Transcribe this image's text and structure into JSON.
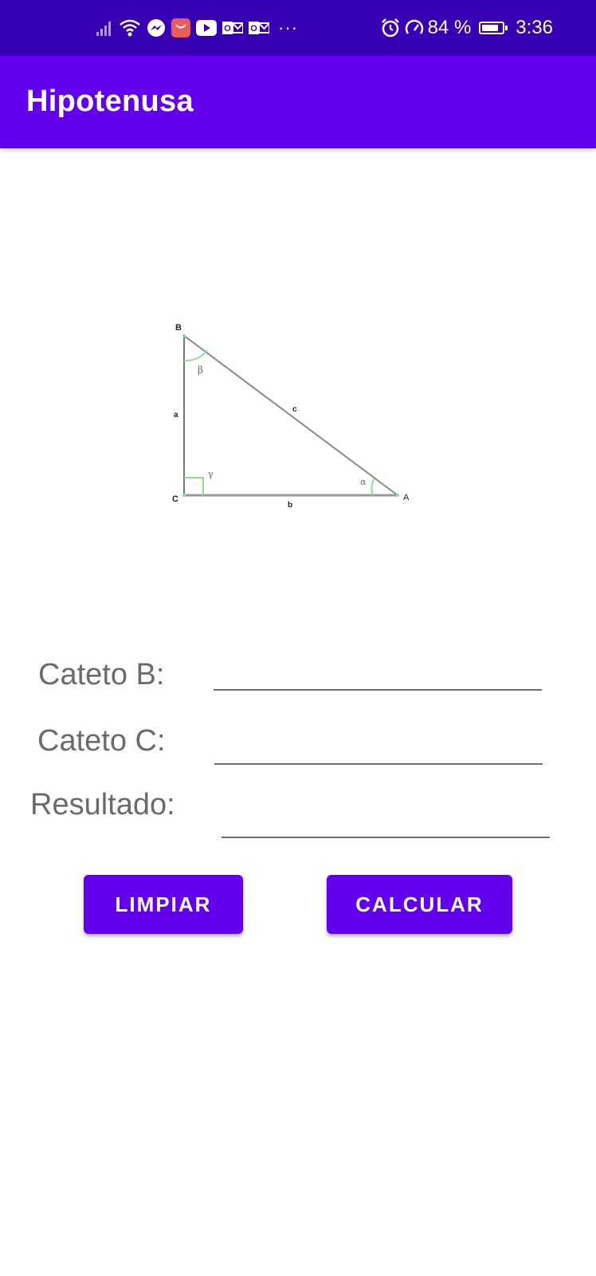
{
  "status_bar": {
    "battery": "84 %",
    "time": "3:36",
    "more": "···",
    "icons": [
      "signal-icon",
      "wifi-icon",
      "messenger-icon",
      "huawei-icon",
      "youtube-icon",
      "outlook-icon",
      "outlook-icon",
      "alarm-icon",
      "data-saver-icon",
      "battery-icon"
    ]
  },
  "app_bar": {
    "title": "Hipotenusa",
    "color": "#6200EE",
    "status_color": "#3700B3"
  },
  "diagram": {
    "vertices": {
      "a": "A",
      "b": "B",
      "c": "C"
    },
    "sides": {
      "a": "a",
      "b": "b",
      "c": "c"
    },
    "angles": {
      "alpha": "α",
      "beta": "β",
      "gamma": "γ"
    }
  },
  "form": {
    "cateto_b_label": "Cateto B:",
    "cateto_b_value": "",
    "cateto_c_label": "Cateto C:",
    "cateto_c_value": "",
    "resultado_label": "Resultado:",
    "resultado_value": ""
  },
  "buttons": {
    "clear": "LIMPIAR",
    "calculate": "CALCULAR"
  }
}
